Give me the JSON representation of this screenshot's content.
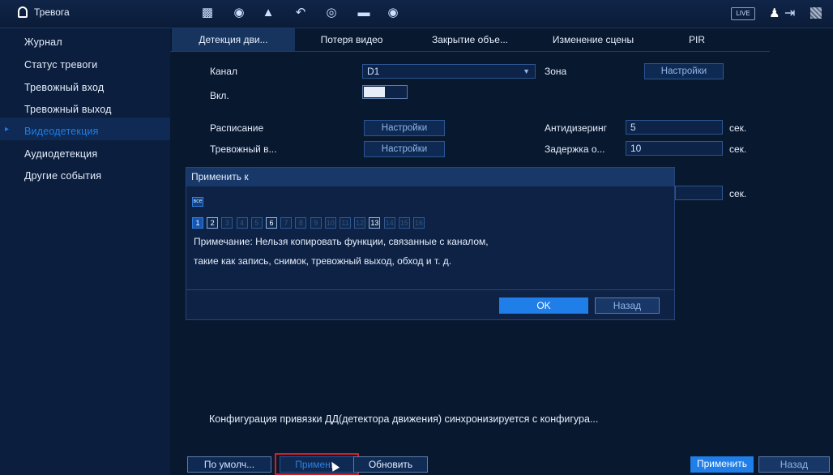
{
  "topbar": {
    "title": "Тревога",
    "icons": [
      "alarm-icon",
      "film-icon",
      "face-icon",
      "person-icon",
      "speedometer-icon",
      "record-icon",
      "monitor-icon",
      "speaker-icon"
    ],
    "live_label": "LIVE"
  },
  "sidebar": {
    "items": [
      {
        "label": "Журнал"
      },
      {
        "label": "Статус тревоги"
      },
      {
        "label": "Тревожный вход"
      },
      {
        "label": "Тревожный выход"
      },
      {
        "label": "Видеодетекция"
      },
      {
        "label": "Аудиодетекция"
      },
      {
        "label": "Другие события"
      }
    ],
    "active_index": 4
  },
  "tabs": [
    {
      "label": "Детекция дви..."
    },
    {
      "label": "Потеря видео"
    },
    {
      "label": "Закрытие объе..."
    },
    {
      "label": "Изменение сцены"
    },
    {
      "label": "PIR"
    }
  ],
  "form": {
    "channel_label": "Канал",
    "channel_value": "D1",
    "zone_label": "Зона",
    "zone_button": "Настройки",
    "enable_label": "Вкл.",
    "enabled": true,
    "schedule_label": "Расписание",
    "schedule_button": "Настройки",
    "alarm_in_label": "Тревожный в...",
    "alarm_in_button": "Настройки",
    "antidither_label": "Антидизеринг",
    "antidither_value": "5",
    "antidither_unit": "сек.",
    "delay_label": "Задержка о...",
    "delay_value": "10",
    "delay_unit": "сек.",
    "extra_unit": "сек."
  },
  "dialog": {
    "title": "Применить к",
    "all_label": "все",
    "channels": [
      {
        "n": "1",
        "state": "on"
      },
      {
        "n": "2",
        "state": "sel"
      },
      {
        "n": "3",
        "state": "off"
      },
      {
        "n": "4",
        "state": "off"
      },
      {
        "n": "5",
        "state": "off"
      },
      {
        "n": "6",
        "state": "sel"
      },
      {
        "n": "7",
        "state": "off"
      },
      {
        "n": "8",
        "state": "off"
      },
      {
        "n": "9",
        "state": "off"
      },
      {
        "n": "10",
        "state": "off"
      },
      {
        "n": "11",
        "state": "off"
      },
      {
        "n": "12",
        "state": "off"
      },
      {
        "n": "13",
        "state": "sel"
      },
      {
        "n": "14",
        "state": "off"
      },
      {
        "n": "15",
        "state": "off"
      },
      {
        "n": "16",
        "state": "off"
      }
    ],
    "note_line1": "Примечание: Нельзя копировать функции, связанные с каналом,",
    "note_line2": "такие как запись, снимок, тревожный выход, обход и т. д.",
    "ok_label": "OK",
    "back_label": "Назад"
  },
  "bottom": {
    "note": "Конфигурация привязки ДД(детектора движения) синхронизируется с конфигура...",
    "default_label": "По умолч...",
    "copy_label": "Примен...",
    "refresh_label": "Обновить",
    "apply_label": "Применить",
    "back_label": "Назад"
  },
  "colors": {
    "accent": "#1f7ee8",
    "background": "#08182f",
    "highlight_border": "#d31e2b"
  }
}
